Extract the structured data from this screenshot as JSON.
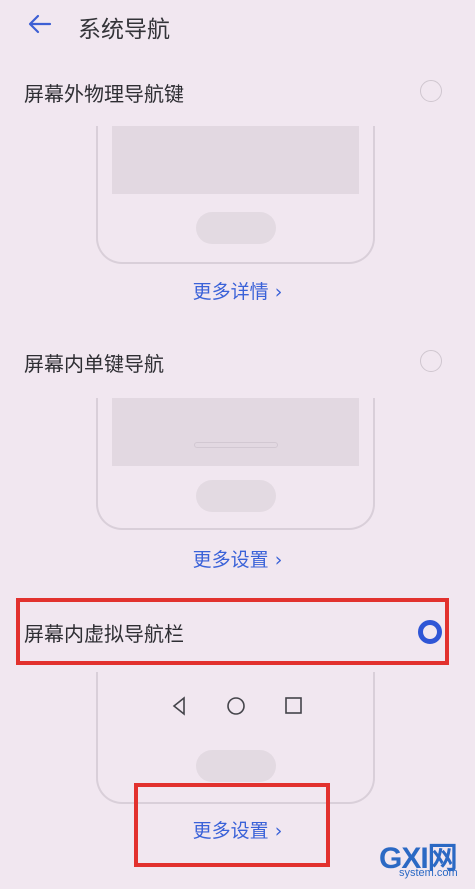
{
  "header": {
    "title": "系统导航"
  },
  "options": [
    {
      "label": "屏幕外物理导航键",
      "link": "更多详情 ›",
      "selected": false
    },
    {
      "label": "屏幕内单键导航",
      "link": "更多设置 ›",
      "selected": false
    },
    {
      "label": "屏幕内虚拟导航栏",
      "link": "更多设置 ›",
      "selected": true
    }
  ],
  "watermark": {
    "logo": "GXI网",
    "site": "system.com"
  },
  "colors": {
    "accent": "#2f56d6",
    "link": "#3a62d8",
    "highlight": "#e2312e",
    "background": "#f1e7f0"
  }
}
